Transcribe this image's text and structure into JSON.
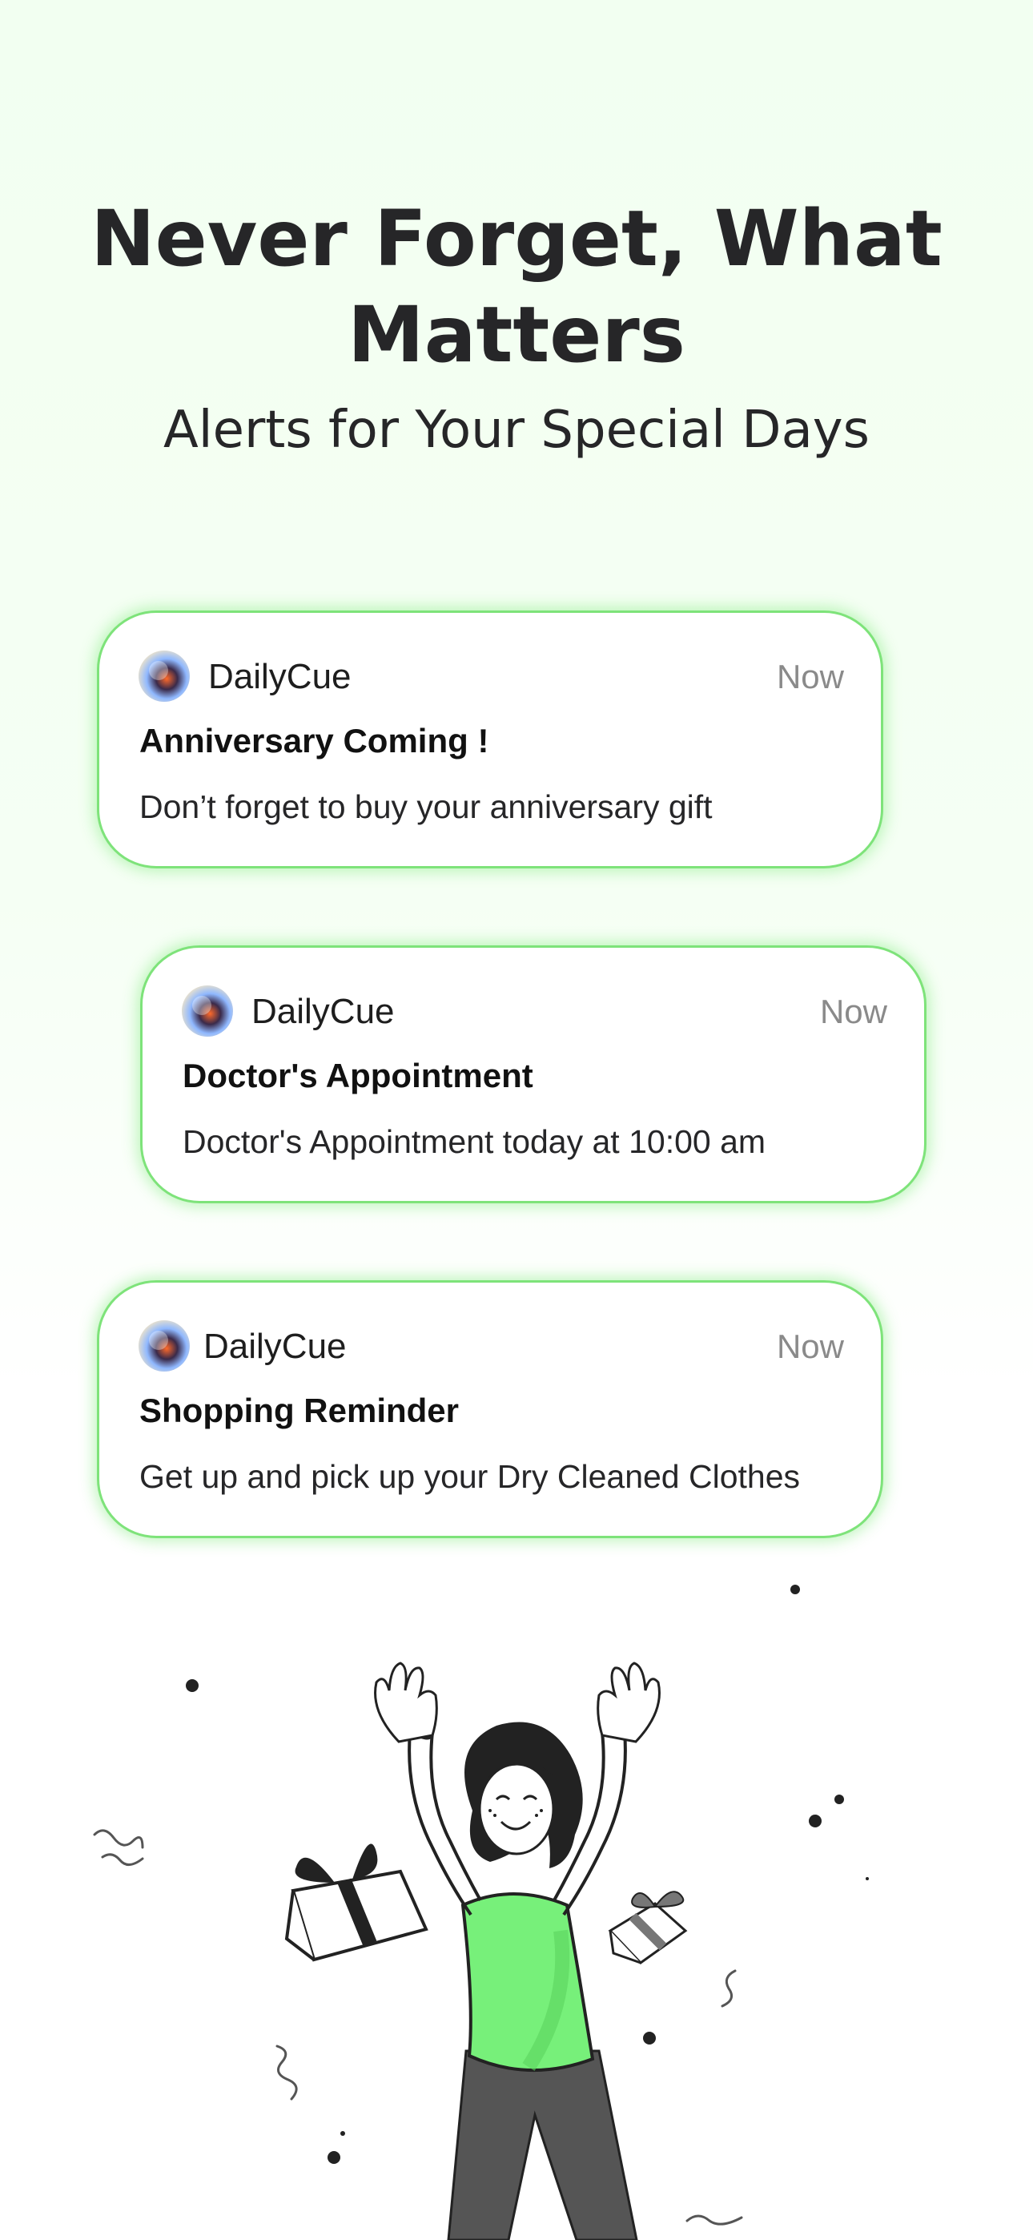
{
  "headline": {
    "line1": "Never Forget, What",
    "line2": "Matters"
  },
  "subheadline": "Alerts for Your Special Days",
  "notifications": [
    {
      "app_name": "DailyCue",
      "time": "Now",
      "title": "Anniversary Coming !",
      "body": "Don’t forget to buy your anniversary gift"
    },
    {
      "app_name": "DailyCue",
      "time": "Now",
      "title": "Doctor's Appointment",
      "body": "Doctor's Appointment today at 10:00 am"
    },
    {
      "app_name": "DailyCue",
      "time": "Now",
      "title": "Shopping Reminder",
      "body": "Get up and pick up your Dry Cleaned Clothes"
    }
  ],
  "icons": {
    "app_icon": "dailycue-app-icon",
    "illustration": "celebrating-woman-with-gifts"
  },
  "colors": {
    "accent_green": "#77f07a",
    "card_border": "#7ee37a",
    "background_tint": "#f2fff1",
    "text_dark": "#262628",
    "time_gray": "#8a8a8a"
  }
}
